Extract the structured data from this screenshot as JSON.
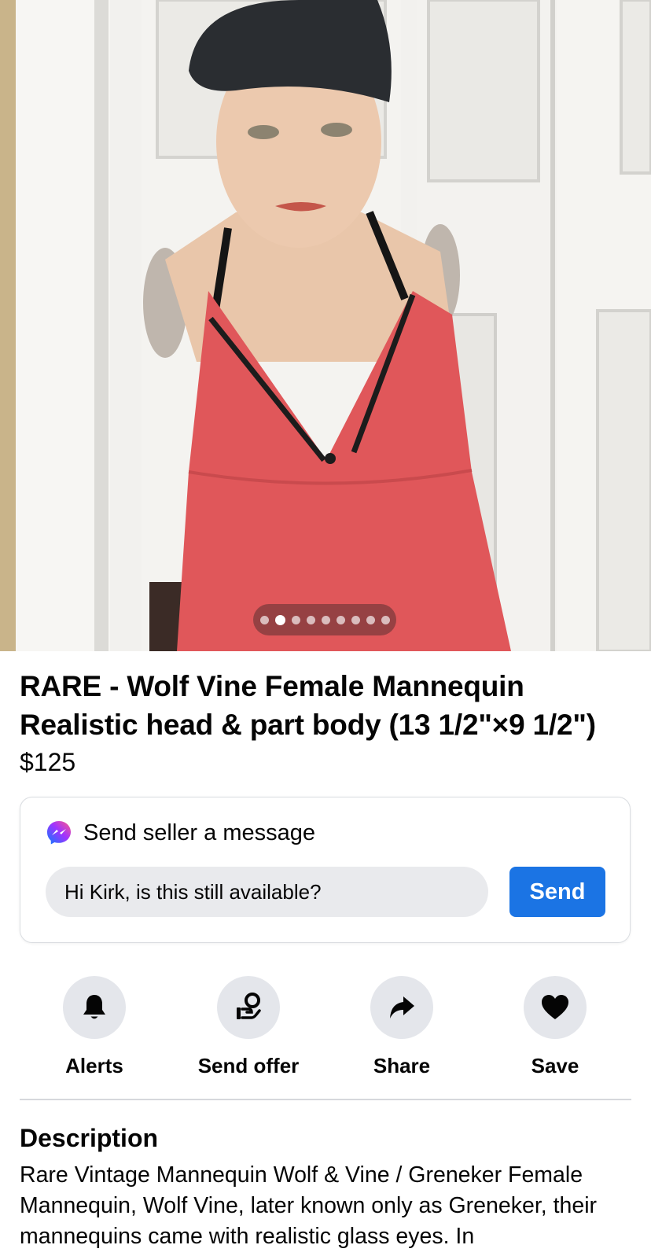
{
  "photo": {
    "image_count": 9,
    "active_index": 1
  },
  "listing": {
    "title": "RARE - Wolf Vine Female Mannequin Realistic head & part body (13 1/2\"×9 1/2\")",
    "price": "$125"
  },
  "message": {
    "heading": "Send seller a message",
    "input_value": "Hi Kirk, is this still available?",
    "send_label": "Send"
  },
  "actions": [
    {
      "label": "Alerts",
      "icon": "bell-icon"
    },
    {
      "label": "Send offer",
      "icon": "offer-icon"
    },
    {
      "label": "Share",
      "icon": "share-arrow-icon"
    },
    {
      "label": "Save",
      "icon": "heart-icon"
    }
  ],
  "description": {
    "heading": "Description",
    "text": "Rare Vintage Mannequin Wolf & Vine / Greneker Female Mannequin, Wolf Vine, later known only as Greneker, their mannequins came with realistic glass eyes. In"
  },
  "colors": {
    "accent": "#1b74e4",
    "dress": "#e0575a"
  }
}
